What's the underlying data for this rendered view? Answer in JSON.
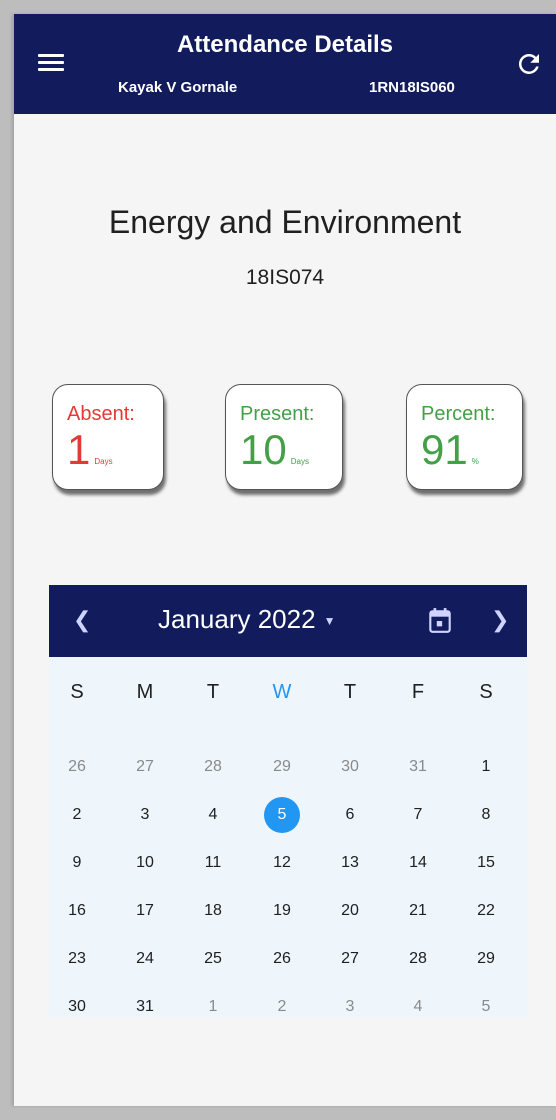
{
  "header": {
    "title": "Attendance Details",
    "student_name": "Kayak V Gornale",
    "usn": "1RN18IS060",
    "menu_icon": "menu-icon",
    "refresh_icon": "refresh-icon",
    "background_color": "#121c5c"
  },
  "subject": {
    "name": "Energy and Environment",
    "code": "18IS074"
  },
  "stats": {
    "absent": {
      "label": "Absent:",
      "value": "1",
      "unit": "Days",
      "color": "#e53935"
    },
    "present": {
      "label": "Present:",
      "value": "10",
      "unit": "Days",
      "color": "#43a047"
    },
    "percent": {
      "label": "Percent:",
      "value": "91",
      "unit": "%",
      "color": "#43a047"
    }
  },
  "calendar": {
    "month_label": "January 2022",
    "prev_icon": "chevron-left-icon",
    "next_icon": "chevron-right-icon",
    "calendar_icon": "calendar-icon",
    "weekdays": [
      "S",
      "M",
      "T",
      "W",
      "T",
      "F",
      "S"
    ],
    "today_weekday_index": 3,
    "selected_day": "5",
    "accent_color": "#2196f3",
    "weeks": [
      [
        {
          "d": "26",
          "m": true
        },
        {
          "d": "27",
          "m": true
        },
        {
          "d": "28",
          "m": true
        },
        {
          "d": "29",
          "m": true
        },
        {
          "d": "30",
          "m": true
        },
        {
          "d": "31",
          "m": true
        },
        {
          "d": "1",
          "m": false
        }
      ],
      [
        {
          "d": "2",
          "m": false
        },
        {
          "d": "3",
          "m": false
        },
        {
          "d": "4",
          "m": false
        },
        {
          "d": "5",
          "m": false,
          "sel": true
        },
        {
          "d": "6",
          "m": false
        },
        {
          "d": "7",
          "m": false
        },
        {
          "d": "8",
          "m": false
        }
      ],
      [
        {
          "d": "9",
          "m": false
        },
        {
          "d": "10",
          "m": false
        },
        {
          "d": "11",
          "m": false
        },
        {
          "d": "12",
          "m": false
        },
        {
          "d": "13",
          "m": false
        },
        {
          "d": "14",
          "m": false
        },
        {
          "d": "15",
          "m": false
        }
      ],
      [
        {
          "d": "16",
          "m": false
        },
        {
          "d": "17",
          "m": false
        },
        {
          "d": "18",
          "m": false
        },
        {
          "d": "19",
          "m": false
        },
        {
          "d": "20",
          "m": false
        },
        {
          "d": "21",
          "m": false
        },
        {
          "d": "22",
          "m": false
        }
      ],
      [
        {
          "d": "23",
          "m": false
        },
        {
          "d": "24",
          "m": false
        },
        {
          "d": "25",
          "m": false
        },
        {
          "d": "26",
          "m": false
        },
        {
          "d": "27",
          "m": false
        },
        {
          "d": "28",
          "m": false
        },
        {
          "d": "29",
          "m": false
        }
      ],
      [
        {
          "d": "30",
          "m": false
        },
        {
          "d": "31",
          "m": false
        },
        {
          "d": "1",
          "m": true
        },
        {
          "d": "2",
          "m": true
        },
        {
          "d": "3",
          "m": true
        },
        {
          "d": "4",
          "m": true
        },
        {
          "d": "5",
          "m": true
        }
      ]
    ]
  }
}
